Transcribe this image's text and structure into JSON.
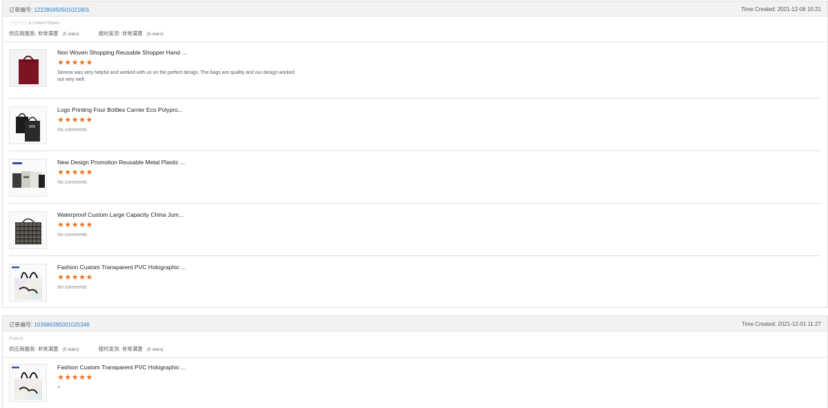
{
  "orders": [
    {
      "order_label": "订单编号:",
      "order_number": "122280450501021801",
      "time_created": "Time Created: 2021-12-06 10:21",
      "buyer_country": "e,United States",
      "supplier_service_label": "供应商服务:",
      "supplier_service_value": "非常满意",
      "supplier_service_stars": "(5 stars)",
      "on_time_label": "按时发货:",
      "on_time_value": "非常满意",
      "on_time_stars": "(5 stars)",
      "items": [
        {
          "title": "Non Woven Shopping Reusable Shopper Hand ...",
          "stars": "★★★★★",
          "comment": "Serena was very helpful and worked with us on the perfect design. The bags are quality and our design worked out very well.",
          "thumb": "red-bag"
        },
        {
          "title": "Logo Printing Four Bottles Carrier Eco Polypro...",
          "stars": "★★★★★",
          "comment": "No comments",
          "thumb": "black-bags"
        },
        {
          "title": "New Design Promotion Reusable Metal Plastic ...",
          "stars": "★★★★★",
          "comment": "No comments",
          "thumb": "metal-bags"
        },
        {
          "title": "Waterproof Custom Large Capacity China Jum...",
          "stars": "★★★★★",
          "comment": "No comments",
          "thumb": "plaid-bag"
        },
        {
          "title": "Fashion Custom Transparent PVC Holographic ...",
          "stars": "★★★★★",
          "comment": "No comments",
          "thumb": "holo-bag"
        }
      ]
    },
    {
      "order_label": "订单编号:",
      "order_number": "103686395001025348",
      "time_created": "Time Created: 2021-12-01 11:27",
      "buyer_country": "France",
      "supplier_service_label": "供应商服务:",
      "supplier_service_value": "非常满意",
      "supplier_service_stars": "(5 stars)",
      "on_time_label": "按时发货:",
      "on_time_value": "非常满意",
      "on_time_stars": "(5 stars)",
      "items": [
        {
          "title": "Fashion Custom Transparent PVC Holographic ...",
          "stars": "★★★★★",
          "comment": "+",
          "thumb": "holo-bag"
        }
      ]
    }
  ],
  "colors": {
    "accent_link": "#2a7cc7",
    "star": "#e8711e",
    "header_bg": "#f2f2f2"
  }
}
